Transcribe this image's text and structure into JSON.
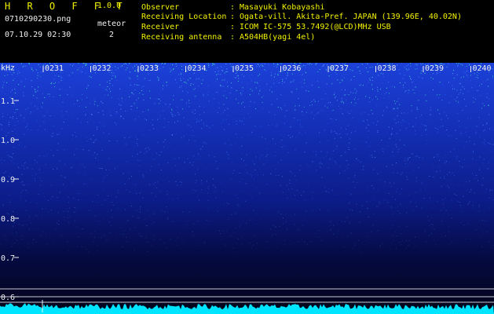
{
  "header": {
    "app_name": "H R O F F T",
    "version": "1.0.0",
    "file_name": "0710290230.png",
    "datetime": "07.10.29 02:30",
    "meteor_label": "meteor",
    "meteor_count": "2",
    "info": [
      {
        "label": "Observer",
        "value": "Masayuki Kobayashi"
      },
      {
        "label": "Receiving Location",
        "value": "Ogata-vill. Akita-Pref. JAPAN (139.96E, 40.02N)"
      },
      {
        "label": "Receiver",
        "value": "ICOM IC-575 53.7492(@LCD)MHz USB"
      },
      {
        "label": "Receiving antenna",
        "value": "A504HB(yagi 4el)"
      }
    ]
  },
  "spectrogram": {
    "y_unit": "kHz",
    "y_ticks": [
      "1.1",
      "1.0",
      "0.9",
      "0.8",
      "0.7",
      "0.6"
    ],
    "time_ticks": [
      "0231",
      "0232",
      "0233",
      "0234",
      "0235",
      "0236",
      "0237",
      "0238",
      "0239",
      "0240"
    ],
    "colors": {
      "noise_low": "#000066",
      "noise_high": "#2a6cff",
      "hot": "#40e0c0",
      "trace": "#00e5ff"
    }
  }
}
